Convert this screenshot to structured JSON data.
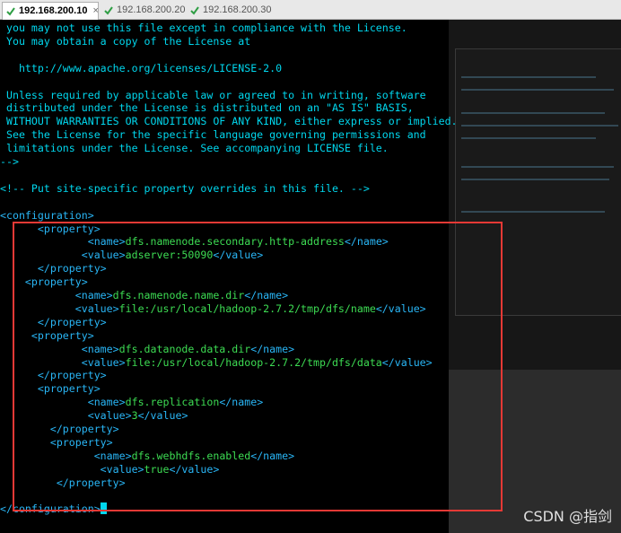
{
  "tabs": [
    {
      "label": "192.168.200.10",
      "active": true
    },
    {
      "label": "192.168.200.20",
      "active": false
    },
    {
      "label": "192.168.200.30",
      "active": false
    }
  ],
  "tab_close_glyph": "×",
  "terminal_lines": [
    [
      {
        "t": " you may not use this file except in compliance with the License.",
        "c": "cm"
      }
    ],
    [
      {
        "t": " You may obtain a copy of the License at",
        "c": "cm"
      }
    ],
    [
      {
        "t": "",
        "c": "cm"
      }
    ],
    [
      {
        "t": "   http://www.apache.org/licenses/LICENSE-2.0",
        "c": "cm"
      }
    ],
    [
      {
        "t": "",
        "c": "cm"
      }
    ],
    [
      {
        "t": " Unless required by applicable law or agreed to in writing, software",
        "c": "cm"
      }
    ],
    [
      {
        "t": " distributed under the License is distributed on an \"AS IS\" BASIS,",
        "c": "cm"
      }
    ],
    [
      {
        "t": " WITHOUT WARRANTIES OR CONDITIONS OF ANY KIND, either express or implied.",
        "c": "cm"
      }
    ],
    [
      {
        "t": " See the License for the specific language governing permissions and",
        "c": "cm"
      }
    ],
    [
      {
        "t": " limitations under the License. See accompanying LICENSE file.",
        "c": "cm"
      }
    ],
    [
      {
        "t": "-->",
        "c": "cm"
      }
    ],
    [
      {
        "t": "",
        "c": "cm"
      }
    ],
    [
      {
        "t": "<!-- Put site-specific property overrides in this file. -->",
        "c": "cm"
      }
    ],
    [
      {
        "t": "",
        "c": "cm"
      }
    ],
    [
      {
        "t": "<configuration>",
        "c": "tag"
      }
    ],
    [
      {
        "t": "      <property>",
        "c": "tag"
      }
    ],
    [
      {
        "t": "              <name>",
        "c": "tag"
      },
      {
        "t": "dfs.namenode.secondary.http-address",
        "c": "val"
      },
      {
        "t": "</name>",
        "c": "tag"
      }
    ],
    [
      {
        "t": "             <value>",
        "c": "tag"
      },
      {
        "t": "adserver:50090",
        "c": "val"
      },
      {
        "t": "</value>",
        "c": "tag"
      }
    ],
    [
      {
        "t": "      </property>",
        "c": "tag"
      }
    ],
    [
      {
        "t": "    <property>",
        "c": "tag"
      }
    ],
    [
      {
        "t": "            <name>",
        "c": "tag"
      },
      {
        "t": "dfs.namenode.name.dir",
        "c": "val"
      },
      {
        "t": "</name>",
        "c": "tag"
      }
    ],
    [
      {
        "t": "            <value>",
        "c": "tag"
      },
      {
        "t": "file:/usr/local/hadoop-2.7.2/tmp/dfs/name",
        "c": "val"
      },
      {
        "t": "</value>",
        "c": "tag"
      }
    ],
    [
      {
        "t": "      </property>",
        "c": "tag"
      }
    ],
    [
      {
        "t": "     <property>",
        "c": "tag"
      }
    ],
    [
      {
        "t": "             <name>",
        "c": "tag"
      },
      {
        "t": "dfs.datanode.data.dir",
        "c": "val"
      },
      {
        "t": "</name>",
        "c": "tag"
      }
    ],
    [
      {
        "t": "             <value>",
        "c": "tag"
      },
      {
        "t": "file:/usr/local/hadoop-2.7.2/tmp/dfs/data",
        "c": "val"
      },
      {
        "t": "</value>",
        "c": "tag"
      }
    ],
    [
      {
        "t": "      </property>",
        "c": "tag"
      }
    ],
    [
      {
        "t": "      <property>",
        "c": "tag"
      }
    ],
    [
      {
        "t": "              <name>",
        "c": "tag"
      },
      {
        "t": "dfs.replication",
        "c": "val"
      },
      {
        "t": "</name>",
        "c": "tag"
      }
    ],
    [
      {
        "t": "              <value>",
        "c": "tag"
      },
      {
        "t": "3",
        "c": "val"
      },
      {
        "t": "</value>",
        "c": "tag"
      }
    ],
    [
      {
        "t": "        </property>",
        "c": "tag"
      }
    ],
    [
      {
        "t": "        <property>",
        "c": "tag"
      }
    ],
    [
      {
        "t": "               <name>",
        "c": "tag"
      },
      {
        "t": "dfs.webhdfs.enabled",
        "c": "val"
      },
      {
        "t": "</name>",
        "c": "tag"
      }
    ],
    [
      {
        "t": "                <value>",
        "c": "tag"
      },
      {
        "t": "true",
        "c": "val"
      },
      {
        "t": "</value>",
        "c": "tag"
      }
    ],
    [
      {
        "t": "         </property>",
        "c": "tag"
      }
    ],
    [
      {
        "t": "",
        "c": "cm"
      }
    ],
    [
      {
        "t": "</configuration>",
        "c": "tag"
      },
      {
        "cursor": true
      }
    ]
  ],
  "watermark": "CSDN @指剑",
  "colors": {
    "comment": "#00d7ee",
    "tag": "#29b6f6",
    "value": "#3ddc53",
    "highlight_box": "#e53935",
    "tab_check": "#2e9e44"
  }
}
